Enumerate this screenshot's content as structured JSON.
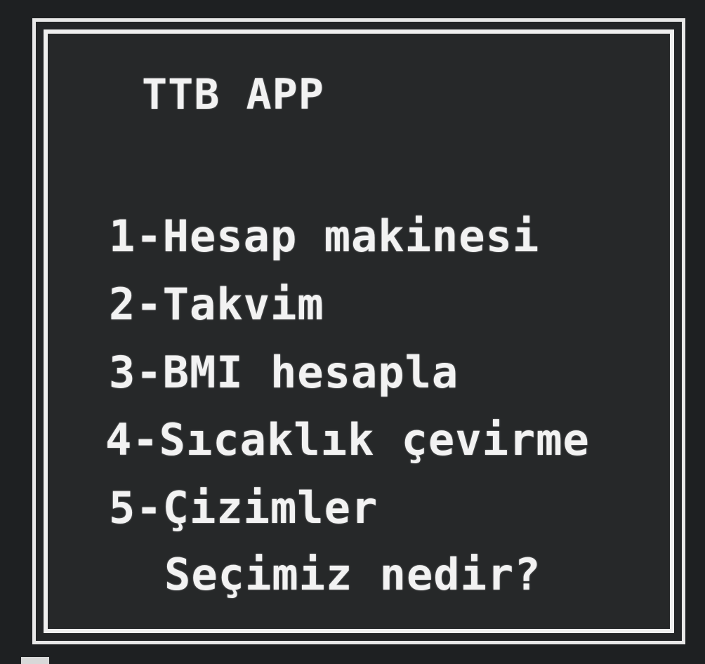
{
  "app": {
    "title": "TTB APP"
  },
  "menu": {
    "items": [
      {
        "label": "1-Hesap makinesi"
      },
      {
        "label": "2-Takvim"
      },
      {
        "label": "3-BMI hesapla"
      },
      {
        "label": "4-Sıcaklık çevirme"
      },
      {
        "label": "5-Çizimler"
      }
    ]
  },
  "prompt": {
    "text": "Seçimiz nedir?"
  },
  "colors": {
    "background": "#1e2022",
    "frame": "#efefef",
    "text": "#f2f2f2"
  }
}
